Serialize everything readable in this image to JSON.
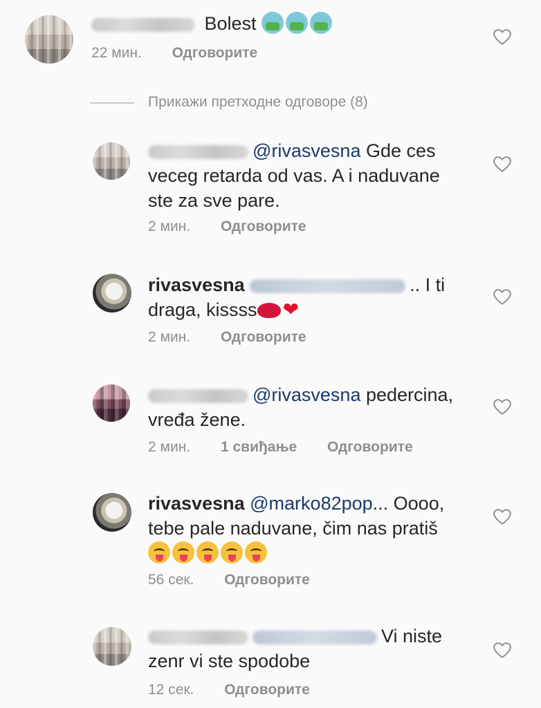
{
  "show_previous": "Прикажи претходне одговоре (8)",
  "reply_label": "Одговорите",
  "comments": [
    {
      "username": "",
      "text": "Bolest",
      "time": "22 мин.",
      "likes": ""
    },
    {
      "username": "",
      "mention": "@rivasvesna",
      "text_line1": " Gde ces",
      "text_line2": "veceg retarda od vas. A i naduvane",
      "text_line3": "ste  za sve pare.",
      "time": "2 мин."
    },
    {
      "username": "rivasvesna",
      "text_line1": ".. I ti",
      "text_line2": "draga, kissss",
      "time": "2 мин."
    },
    {
      "username": "",
      "mention": "@rivasvesna",
      "text_line1": " pedercina,",
      "text_line2": "vređa žene.",
      "time": "2 мин.",
      "likes": "1 свиђање"
    },
    {
      "username": "rivasvesna",
      "mention": "@marko82pop",
      "text_line1": "... Oooo,",
      "text_line2": "tebe pale naduvane, čim nas pratiš",
      "time": "56 сек."
    },
    {
      "username": "",
      "text_line1": "Vi niste",
      "text_line2": "zenr vi ste spodobe",
      "time": "12 сек."
    }
  ],
  "icons": {
    "like": "heart-outline-icon",
    "sick": "nauseated-face-emoji",
    "tongue": "winking-tongue-face-emoji",
    "lips": "kiss-mark-emoji",
    "heart": "red-heart-emoji"
  },
  "colors": {
    "mention": "#1b3a6b",
    "meta": "#8e8e8e",
    "text": "#262626"
  }
}
